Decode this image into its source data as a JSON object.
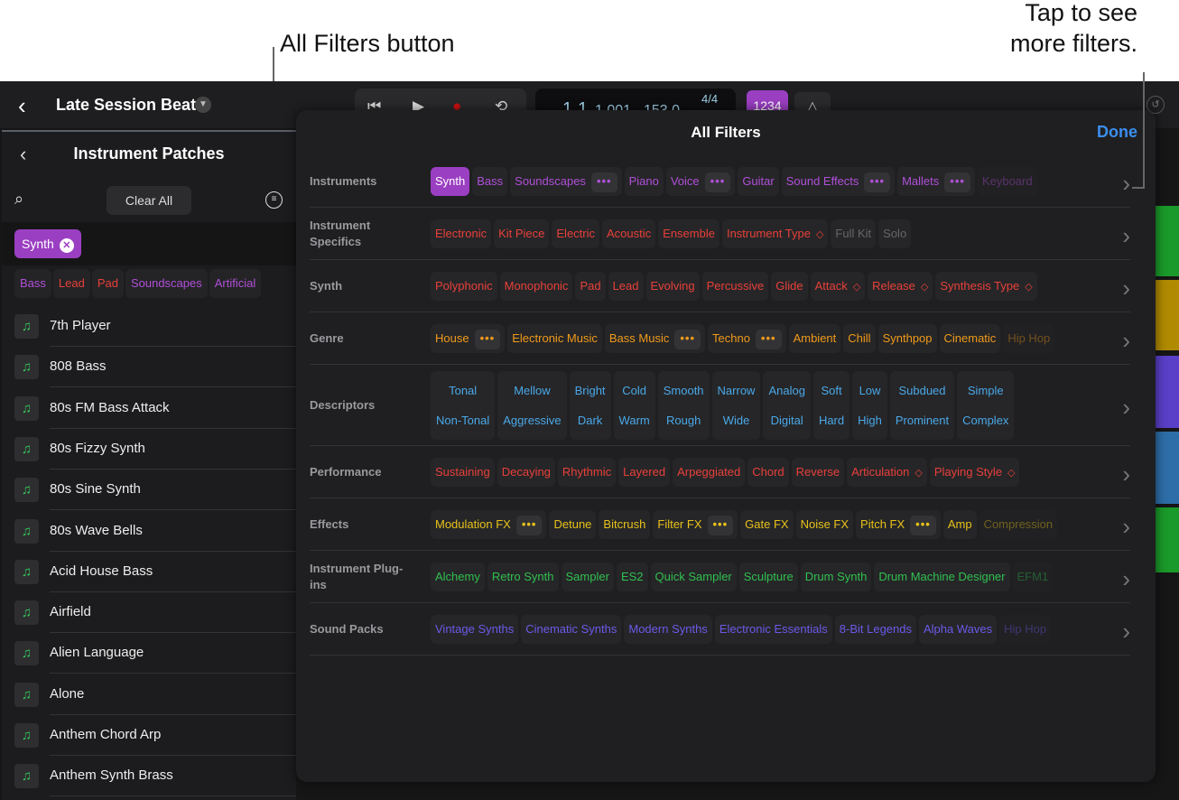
{
  "callouts": {
    "left": "All Filters button",
    "right_line1": "Tap to see",
    "right_line2": "more filters."
  },
  "topbar": {
    "back": "‹",
    "title": "Late Session Beat",
    "position": [
      "1",
      "1",
      "1 001"
    ],
    "tempo": "153.0",
    "signature": "4/4",
    "count_in": "1234"
  },
  "left_panel": {
    "title": "Instrument Patches",
    "clear_all": "Clear All",
    "selected_filter": "Synth",
    "sub_tags": [
      {
        "label": "Bass",
        "color": "#b04fd8"
      },
      {
        "label": "Lead",
        "color": "#e8403a"
      },
      {
        "label": "Pad",
        "color": "#e8403a"
      },
      {
        "label": "Soundscapes",
        "color": "#b04fd8"
      },
      {
        "label": "Artificial",
        "color": "#b04fd8"
      }
    ],
    "patches": [
      "7th Player",
      "808 Bass",
      "80s FM Bass Attack",
      "80s Fizzy Synth",
      "80s Sine Synth",
      "80s Wave Bells",
      "Acid House Bass",
      "Airfield",
      "Alien Language",
      "Alone",
      "Anthem Chord Arp",
      "Anthem Synth Brass"
    ]
  },
  "all_filters": {
    "title": "All Filters",
    "done": "Done",
    "rows": [
      {
        "label": "Instruments",
        "color": "#b04fd8",
        "chips": [
          {
            "label": "Synth",
            "selected": true
          },
          {
            "label": "Bass"
          },
          {
            "label": "Soundscapes",
            "more": true
          },
          {
            "label": "Piano"
          },
          {
            "label": "Voice",
            "more": true
          },
          {
            "label": "Guitar"
          },
          {
            "label": "Sound Effects",
            "more": true
          },
          {
            "label": "Mallets",
            "more": true
          },
          {
            "label": "Keyboard",
            "faded": true
          }
        ]
      },
      {
        "label": "Instrument Specifics",
        "color": "#e8403a",
        "chips": [
          {
            "label": "Electronic"
          },
          {
            "label": "Kit Piece"
          },
          {
            "label": "Electric"
          },
          {
            "label": "Acoustic"
          },
          {
            "label": "Ensemble"
          },
          {
            "label": "Instrument Type",
            "menu": true
          },
          {
            "label": "Full Kit",
            "disabled": true
          },
          {
            "label": "Solo",
            "disabled": true
          }
        ]
      },
      {
        "label": "Synth",
        "color": "#e8403a",
        "chips": [
          {
            "label": "Polyphonic"
          },
          {
            "label": "Monophonic"
          },
          {
            "label": "Pad"
          },
          {
            "label": "Lead"
          },
          {
            "label": "Evolving"
          },
          {
            "label": "Percussive"
          },
          {
            "label": "Glide"
          },
          {
            "label": "Attack",
            "menu": true
          },
          {
            "label": "Release",
            "menu": true
          },
          {
            "label": "Synthesis Type",
            "menu": true
          }
        ]
      },
      {
        "label": "Genre",
        "color": "#f09a1a",
        "chips": [
          {
            "label": "House",
            "more": true
          },
          {
            "label": "Electronic Music"
          },
          {
            "label": "Bass Music",
            "more": true
          },
          {
            "label": "Techno",
            "more": true
          },
          {
            "label": "Ambient"
          },
          {
            "label": "Chill"
          },
          {
            "label": "Synthpop"
          },
          {
            "label": "Cinematic"
          },
          {
            "label": "Hip Hop",
            "faded": true
          }
        ]
      },
      {
        "label": "Descriptors",
        "color": "#4aa8e8",
        "pairs": [
          [
            "Tonal",
            "Non-Tonal"
          ],
          [
            "Mellow",
            "Aggressive"
          ],
          [
            "Bright",
            "Dark"
          ],
          [
            "Cold",
            "Warm"
          ],
          [
            "Smooth",
            "Rough"
          ],
          [
            "Narrow",
            "Wide"
          ],
          [
            "Analog",
            "Digital"
          ],
          [
            "Soft",
            "Hard"
          ],
          [
            "Low",
            "High"
          ],
          [
            "Subdued",
            "Prominent"
          ],
          [
            "Simple",
            "Complex"
          ]
        ]
      },
      {
        "label": "Performance",
        "color": "#e8403a",
        "chips": [
          {
            "label": "Sustaining"
          },
          {
            "label": "Decaying"
          },
          {
            "label": "Rhythmic"
          },
          {
            "label": "Layered"
          },
          {
            "label": "Arpeggiated"
          },
          {
            "label": "Chord"
          },
          {
            "label": "Reverse"
          },
          {
            "label": "Articulation",
            "menu": true
          },
          {
            "label": "Playing Style",
            "menu": true
          }
        ]
      },
      {
        "label": "Effects",
        "color": "#e8c21a",
        "chips": [
          {
            "label": "Modulation FX",
            "more": true
          },
          {
            "label": "Detune"
          },
          {
            "label": "Bitcrush"
          },
          {
            "label": "Filter FX",
            "more": true
          },
          {
            "label": "Gate FX"
          },
          {
            "label": "Noise FX"
          },
          {
            "label": "Pitch FX",
            "more": true
          },
          {
            "label": "Amp"
          },
          {
            "label": "Compression",
            "faded": true
          }
        ]
      },
      {
        "label": "Instrument Plug-ins",
        "color": "#30c050",
        "chips": [
          {
            "label": "Alchemy"
          },
          {
            "label": "Retro Synth"
          },
          {
            "label": "Sampler"
          },
          {
            "label": "ES2"
          },
          {
            "label": "Quick Sampler"
          },
          {
            "label": "Sculpture"
          },
          {
            "label": "Drum Synth"
          },
          {
            "label": "Drum Machine Designer"
          },
          {
            "label": "EFM1",
            "faded": true
          }
        ]
      },
      {
        "label": "Sound Packs",
        "color": "#6a5ae8",
        "chips": [
          {
            "label": "Vintage Synths"
          },
          {
            "label": "Cinematic Synths"
          },
          {
            "label": "Modern Synths"
          },
          {
            "label": "Electronic Essentials"
          },
          {
            "label": "8-Bit Legends"
          },
          {
            "label": "Alpha Waves"
          },
          {
            "label": "Hip Hop",
            "faded": true
          }
        ]
      }
    ]
  },
  "track_colors": [
    "#1a9a2a",
    "#b08a00",
    "#5a3fc8",
    "#2e6ea8",
    "#1a9a2a"
  ]
}
